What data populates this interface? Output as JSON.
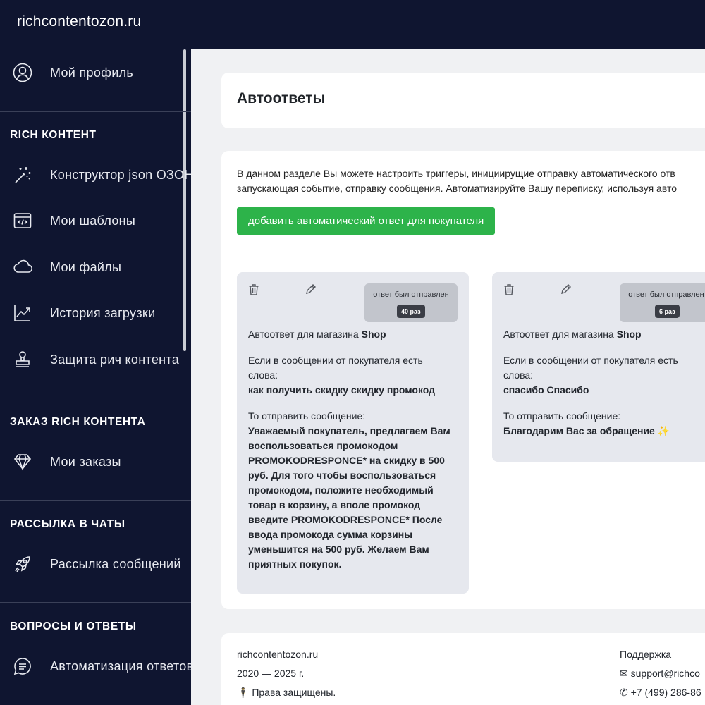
{
  "header": {
    "logo": "richcontentozon.ru"
  },
  "sidebar": {
    "profile": "Мой профиль",
    "sections": [
      {
        "title": "RICH КОНТЕНТ",
        "items": [
          "Конструктор json ОЗОН",
          "Мои шаблоны",
          "Мои файлы",
          "История загрузки",
          "Защита рич контента"
        ]
      },
      {
        "title": "ЗАКАЗ RICH КОНТЕНТА",
        "items": [
          "Мои заказы"
        ]
      },
      {
        "title": "РАССЫЛКА В ЧАТЫ",
        "items": [
          "Рассылка сообщений"
        ]
      },
      {
        "title": "ВОПРОСЫ И ОТВЕТЫ",
        "items": [
          "Автоматизация ответов"
        ]
      }
    ],
    "icons": [
      "user-icon",
      "magic-wand-icon",
      "code-window-icon",
      "cloud-icon",
      "chart-line-icon",
      "stamp-icon",
      "diamond-icon",
      "rocket-icon",
      "chat-icon"
    ]
  },
  "main": {
    "title": "Автоответы",
    "description_line1": "В данном разделе Вы можете настроить триггеры, инициирущие отправку автоматического отв",
    "description_line2": "запускающая событие, отправку сообщения. Автоматизируйте Вашу переписку, используя авто",
    "add_button": "добавить автоматический ответ для покупателя",
    "autoresponses": [
      {
        "sent_label": "ответ был отправлен",
        "count": "40 раз",
        "shop_prefix": "Автоответ для магазина ",
        "shop": "Shop",
        "condition_label": "Если в сообщении от покупателя есть слова:",
        "keywords": "как получить скидку скидку промокод",
        "action_label": "То отправить сообщение:",
        "message": "Уважаемый покупатель, предлагаем Вам воспользоваться промокодом PROMOKODRESPONCE* на скидку в 500 руб. Для того чтобы воспользоваться промокодом, положите необходимый товар в корзину, а вполе промокод введите PROMOKODRESPONCE* После ввода промокода сумма корзины уменьшится на 500 руб. Желаем Вам приятных покупок."
      },
      {
        "sent_label": "ответ был отправлен",
        "count": "6 раз",
        "shop_prefix": "Автоответ для магазина ",
        "shop": "Shop",
        "condition_label": "Если в сообщении от покупателя есть слова:",
        "keywords": "спасибо Спасибо",
        "action_label": "То отправить сообщение:",
        "message": "Благодарим Вас за обращение ✨"
      }
    ]
  },
  "footer": {
    "site": "richcontentozon.ru",
    "years": "2020 — 2025 г.",
    "rights": "Права защищены.",
    "support_title": "Поддержка",
    "email": "support@richco",
    "phone": "+7 (499) 286-86"
  },
  "colors": {
    "sidebar_bg": "#0f1530",
    "accent_green": "#2db34a"
  }
}
